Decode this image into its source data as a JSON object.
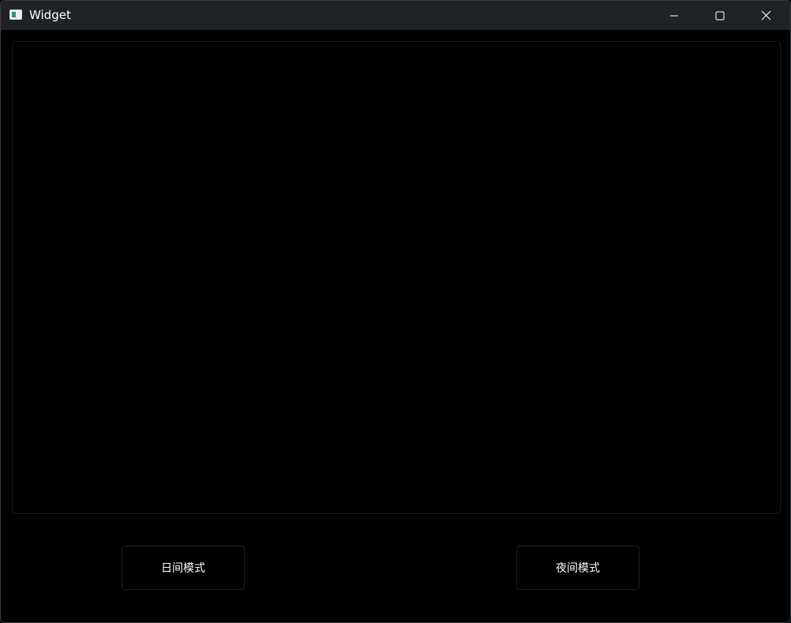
{
  "window": {
    "title": "Widget",
    "icon": "app-window-icon",
    "controls": [
      "minimize-icon",
      "maximize-icon",
      "close-icon"
    ]
  },
  "buttons": {
    "day_mode": "日间模式",
    "night_mode": "夜间模式"
  },
  "colors": {
    "titlebar": "#1f2326",
    "background": "#000000",
    "text": "#ffffff",
    "border": "#1f1f1f"
  }
}
